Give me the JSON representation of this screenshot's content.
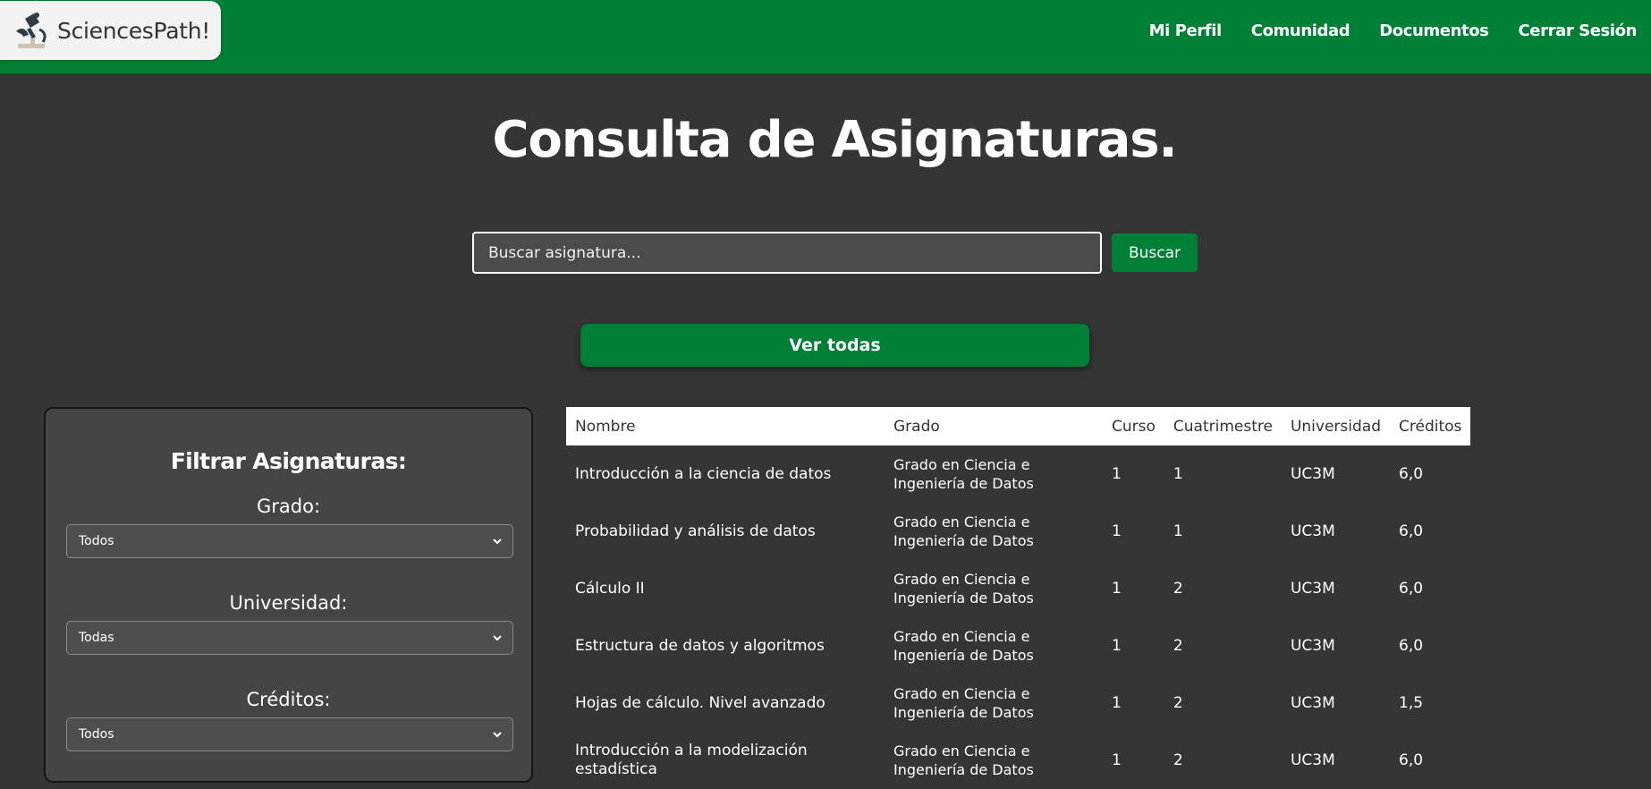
{
  "brand": {
    "name": "SciencesPath!",
    "logo_icon": "microscope-icon"
  },
  "nav": [
    "Mi Perfil",
    "Comunidad",
    "Documentos",
    "Cerrar Sesión"
  ],
  "page_title": "Consulta de Asignaturas.",
  "search": {
    "placeholder": "Buscar asignatura...",
    "value": "",
    "button_label": "Buscar"
  },
  "view_all_label": "Ver todas",
  "filters": {
    "title": "Filtrar Asignaturas:",
    "items": [
      {
        "label": "Grado:",
        "selected": "Todos"
      },
      {
        "label": "Universidad:",
        "selected": "Todas"
      },
      {
        "label": "Créditos:",
        "selected": "Todos"
      }
    ]
  },
  "table": {
    "columns": [
      "Nombre",
      "Grado",
      "Curso",
      "Cuatrimestre",
      "Universidad",
      "Créditos"
    ],
    "rows": [
      [
        "Introducción a la ciencia de datos",
        "Grado en Ciencia e Ingeniería de Datos",
        "1",
        "1",
        "UC3M",
        "6,0"
      ],
      [
        "Probabilidad y análisis de datos",
        "Grado en Ciencia e Ingeniería de Datos",
        "1",
        "1",
        "UC3M",
        "6,0"
      ],
      [
        "Cálculo II",
        "Grado en Ciencia e Ingeniería de Datos",
        "1",
        "2",
        "UC3M",
        "6,0"
      ],
      [
        "Estructura de datos y algoritmos",
        "Grado en Ciencia e Ingeniería de Datos",
        "1",
        "2",
        "UC3M",
        "6,0"
      ],
      [
        "Hojas de cálculo. Nivel avanzado",
        "Grado en Ciencia e Ingeniería de Datos",
        "1",
        "2",
        "UC3M",
        "1,5"
      ],
      [
        "Introducción a la modelización estadística",
        "Grado en Ciencia e Ingeniería de Datos",
        "1",
        "2",
        "UC3M",
        "6,0"
      ]
    ]
  },
  "colors": {
    "nav_green": "#007f36",
    "background": "#353535",
    "panel": "#454545"
  }
}
